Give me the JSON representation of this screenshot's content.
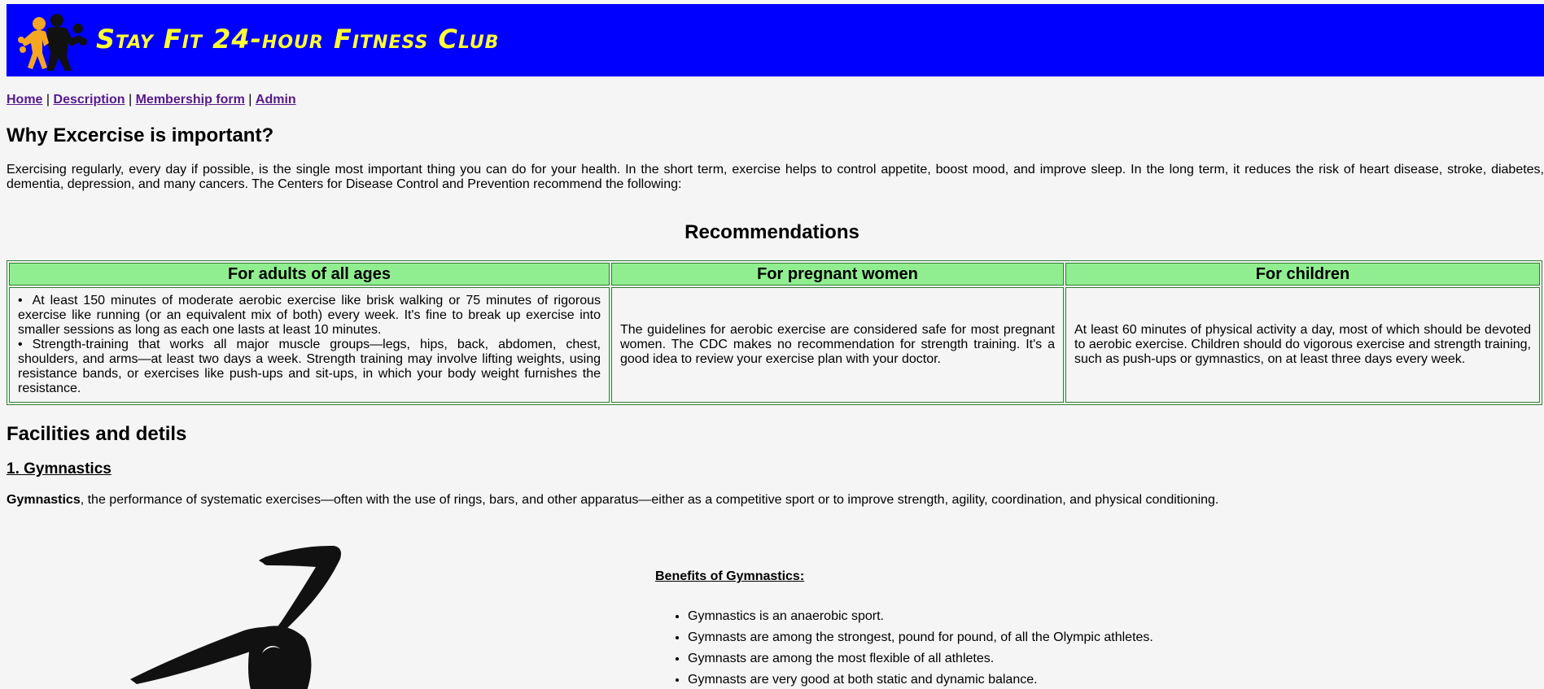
{
  "header": {
    "site_title": "Stay Fit 24-hour Fitness Club",
    "banner_color": "#0000ff",
    "title_color": "#ffff33",
    "logo_icon": "fitness-couple-logo-icon"
  },
  "nav": {
    "items": [
      {
        "label": "Home"
      },
      {
        "label": "Description"
      },
      {
        "label": "Membership form"
      },
      {
        "label": "Admin"
      }
    ],
    "separator": "|"
  },
  "why_section": {
    "heading": "Why Excercise is important?",
    "paragraph": "Exercising regularly, every day if possible, is the single most important thing you can do for your health. In the short term, exercise helps to control appetite, boost mood, and improve sleep. In the long term, it reduces the risk of heart disease, stroke, diabetes, dementia, depression, and many cancers. The Centers for Disease Control and Prevention recommend the following:"
  },
  "recommendations": {
    "heading": "Recommendations",
    "header_color": "#90ee90",
    "columns": [
      {
        "title": "For adults of all ages"
      },
      {
        "title": "For pregnant women"
      },
      {
        "title": "For children"
      }
    ],
    "adults_items": [
      "At least 150 minutes of moderate aerobic exercise like brisk walking or 75 minutes of rigorous exercise like running (or an equivalent mix of both) every week. It's fine to break up exercise into smaller sessions as long as each one lasts at least 10 minutes.",
      "Strength-training that works all major muscle groups—legs, hips, back, abdomen, chest, shoulders, and arms—at least two days a week. Strength training may involve lifting weights, using resistance bands, or exercises like push-ups and sit-ups, in which your body weight furnishes the resistance."
    ],
    "pregnant_text": "The guidelines for aerobic exercise are considered safe for most pregnant women. The CDC makes no recommendation for strength training. It's a good idea to review your exercise plan with your doctor.",
    "children_text": "At least 60 minutes of physical activity a day, most of which should be devoted to aerobic exercise. Children should do vigorous exercise and strength training, such as push-ups or gymnastics, on at least three days every week."
  },
  "facilities": {
    "heading": "Facilities and detils",
    "gymnastics": {
      "heading": "1. Gymnastics",
      "term": "Gymnastics",
      "description": ", the performance of systematic exercises—often with the use of rings, bars, and other apparatus—either as a competitive sport or to improve strength, agility, coordination, and physical conditioning.",
      "image_icon": "gymnast-silhouette-icon",
      "benefits_title": "Benefits of Gymnastics:",
      "benefits": [
        "Gymnastics is an anaerobic sport.",
        "Gymnasts are among the strongest, pound for pound, of all the Olympic athletes.",
        "Gymnasts are among the most flexible of all athletes.",
        "Gymnasts are very good at both static and dynamic balance."
      ]
    }
  }
}
